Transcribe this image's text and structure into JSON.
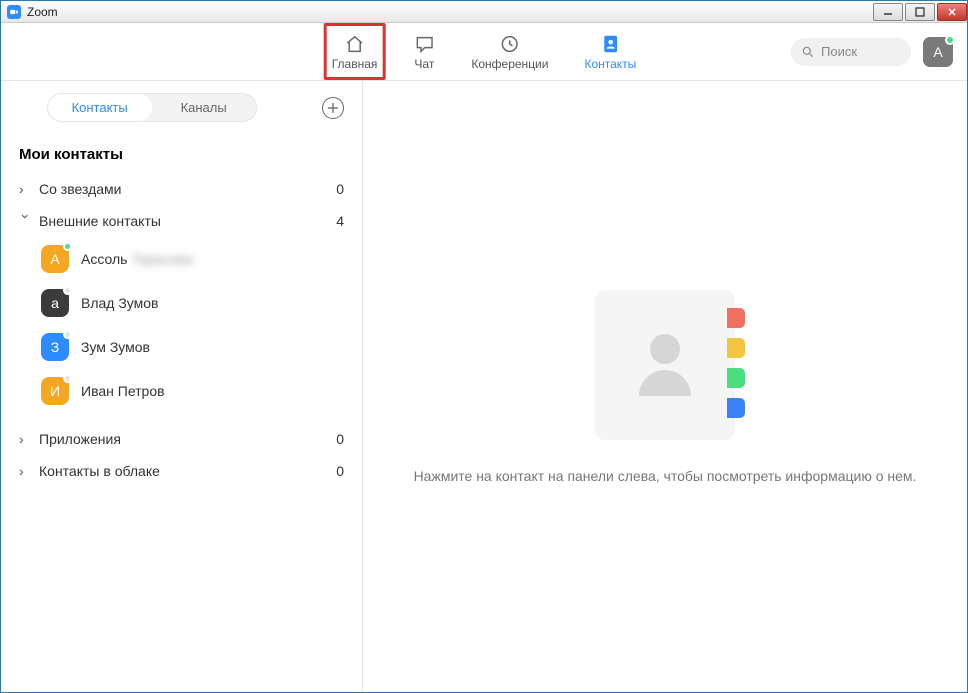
{
  "window": {
    "title": "Zoom"
  },
  "nav": {
    "home": "Главная",
    "chat": "Чат",
    "meetings": "Конференции",
    "contacts": "Контакты"
  },
  "search": {
    "placeholder": "Поиск"
  },
  "profile": {
    "initial": "A"
  },
  "subtabs": {
    "contacts": "Контакты",
    "channels": "Каналы"
  },
  "sidebar": {
    "section_title": "Мои контакты",
    "groups": {
      "starred": {
        "label": "Со звездами",
        "count": "0"
      },
      "external": {
        "label": "Внешние контакты",
        "count": "4"
      },
      "apps": {
        "label": "Приложения",
        "count": "0"
      },
      "cloud": {
        "label": "Контакты в облаке",
        "count": "0"
      }
    },
    "contacts": [
      {
        "initial": "А",
        "name": "Ассоль",
        "extra": "Тарасова",
        "color": "#f5a623",
        "presence": "online"
      },
      {
        "initial": "а",
        "name": "Влад Зумов",
        "color": "#3b3b3b",
        "presence": "offline"
      },
      {
        "initial": "З",
        "name": "Зум Зумов",
        "color": "#2d8cff",
        "presence": "offline"
      },
      {
        "initial": "И",
        "name": "Иван Петров",
        "color": "#f5a623",
        "presence": "offline"
      }
    ]
  },
  "main": {
    "empty_text": "Нажмите на контакт на панели слева, чтобы посмотреть информацию о нем."
  }
}
